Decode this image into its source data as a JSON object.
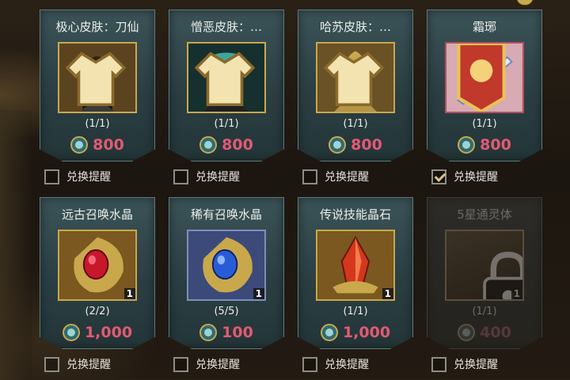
{
  "items": [
    {
      "title": "极心皮肤：刀仙",
      "count": "(1/1)",
      "price": "800",
      "reminder_label": "兑换提醒",
      "reminder_checked": false,
      "qty": "",
      "art": "hero-swordsman",
      "badge": "skin"
    },
    {
      "title": "憎恶皮肤：…",
      "count": "(1/1)",
      "price": "800",
      "reminder_label": "兑换提醒",
      "reminder_checked": false,
      "qty": "",
      "art": "abomination",
      "badge": "skin"
    },
    {
      "title": "哈苏皮肤：…",
      "count": "(1/1)",
      "price": "800",
      "reminder_label": "兑换提醒",
      "reminder_checked": false,
      "qty": "",
      "art": "golden-warrior",
      "badge": "skin"
    },
    {
      "title": "霜琊",
      "count": "(1/1)",
      "price": "800",
      "reminder_label": "兑换提醒",
      "reminder_checked": true,
      "qty": "",
      "art": "frost-weapon",
      "badge": "skull"
    },
    {
      "title": "远古召唤水晶",
      "count": "(2/2)",
      "price": "1,000",
      "reminder_label": "兑换提醒",
      "reminder_checked": false,
      "qty": "1",
      "art": "red-crystal",
      "badge": ""
    },
    {
      "title": "稀有召唤水晶",
      "count": "(5/5)",
      "price": "100",
      "reminder_label": "兑换提醒",
      "reminder_checked": false,
      "qty": "1",
      "art": "blue-crystal",
      "badge": ""
    },
    {
      "title": "传说技能晶石",
      "count": "(1/1)",
      "price": "1,000",
      "reminder_label": "兑换提醒",
      "reminder_checked": false,
      "qty": "1",
      "art": "skill-stone",
      "badge": ""
    },
    {
      "title": "5星通灵体",
      "count": "(1/1)",
      "price": "400",
      "reminder_label": "兑换提醒",
      "reminder_checked": false,
      "qty": "1",
      "art": "locked",
      "badge": "",
      "disabled": true
    }
  ],
  "colors": {
    "price": "#e35a73",
    "card_bg": "#2b3f43",
    "gold_frame": "#c9a84c"
  }
}
